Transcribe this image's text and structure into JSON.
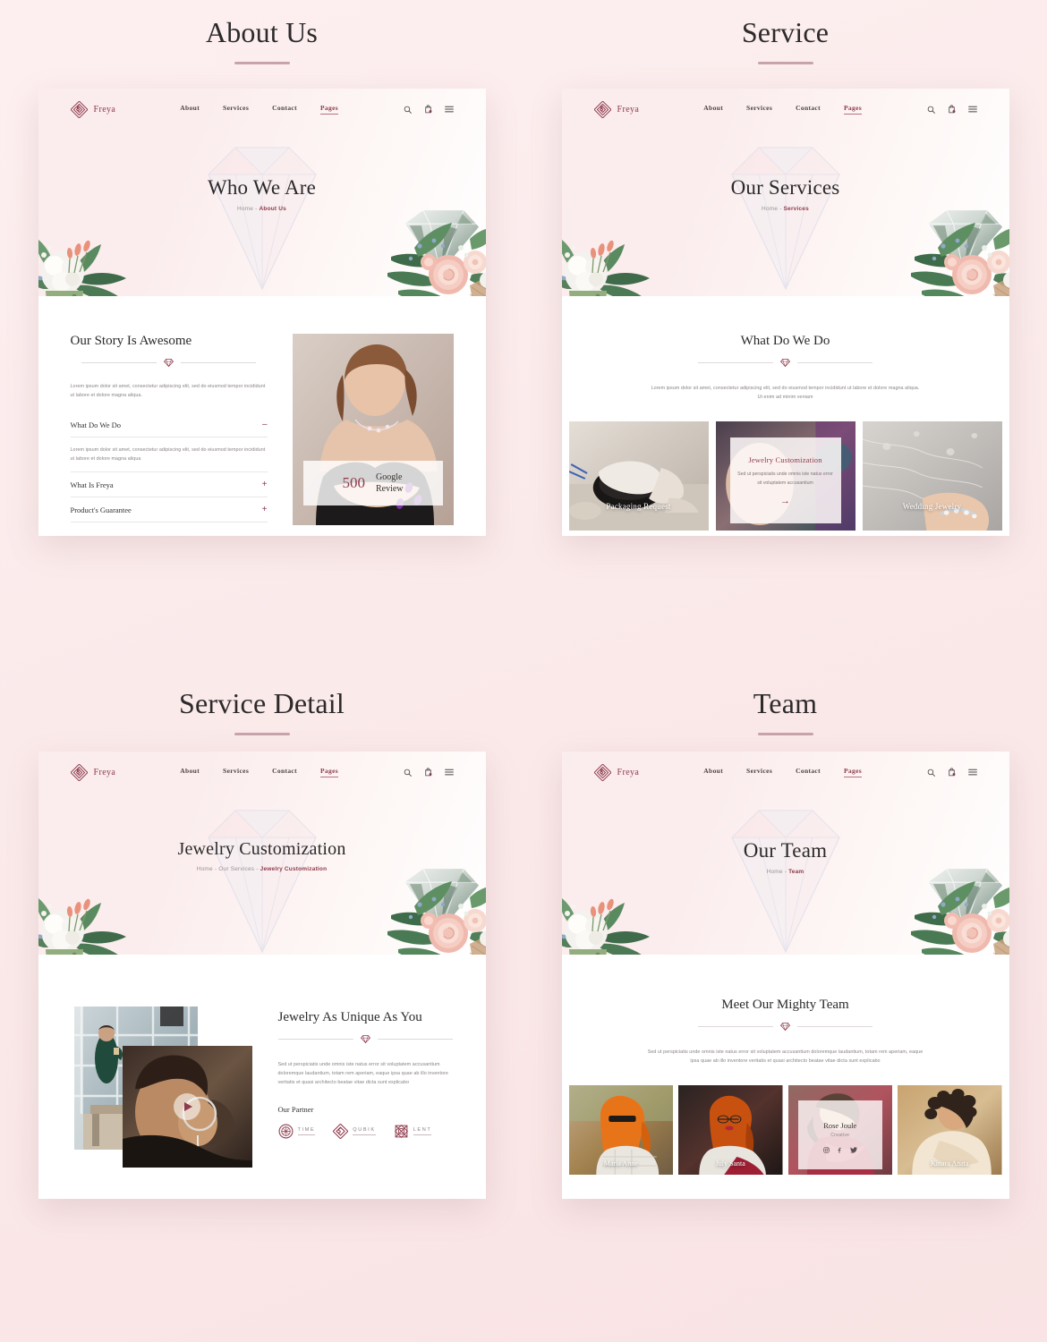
{
  "page": {
    "background_start": "#fdeff0",
    "background_end": "#f9e3e4",
    "accent": "#8e3b4c",
    "rule_color": "#c9a3ab"
  },
  "sections": [
    {
      "title": "About Us"
    },
    {
      "title": "Service"
    },
    {
      "title": "Service Detail"
    },
    {
      "title": "Team"
    }
  ],
  "nav": {
    "brand": "Freya",
    "links": [
      {
        "label": "About",
        "active": false
      },
      {
        "label": "Services",
        "active": false
      },
      {
        "label": "Contact",
        "active": false
      },
      {
        "label": "Pages",
        "active": true
      }
    ],
    "icons": [
      {
        "name": "search-icon"
      },
      {
        "name": "shopping-bag-icon"
      },
      {
        "name": "hamburger-menu-icon"
      }
    ]
  },
  "about": {
    "hero_title": "Who We Are",
    "breadcrumb_home": "Home",
    "breadcrumb_sep": "-",
    "breadcrumb_current": "About Us",
    "story_title": "Our Story Is Awesome",
    "story_text": "Lorem ipsum dolor sit amet, consectetur adipiscing elit, sed do eiusmod tempor incididunt ut labore et dolore magna aliqua.",
    "accordion": [
      {
        "label": "What Do We Do",
        "sign": "–",
        "open": true,
        "body": "Lorem ipsum dolor sit amet, consectetur adipiscing elit, sed do eiusmod tempor incididunt ut labore et dolore magna aliqua"
      },
      {
        "label": "What Is Freya",
        "sign": "+",
        "open": false,
        "body": ""
      },
      {
        "label": "Product's Guarantee",
        "sign": "+",
        "open": false,
        "body": ""
      }
    ],
    "review_number": "500",
    "review_label_line1": "Google",
    "review_label_line2": "Review"
  },
  "service": {
    "hero_title": "Our Services",
    "breadcrumb_home": "Home",
    "breadcrumb_sep": "-",
    "breadcrumb_current": "Services",
    "block_title": "What Do We Do",
    "block_text": "Lorem ipsum dolor sit amet, consectetur adipiscing elit, sed do eiusmod tempor incididunt ut labore et dolore magna aliqua. Ut enim ad minim veniam",
    "cards": [
      {
        "name": "Packaging Request",
        "featured": false
      },
      {
        "name": "Jewelry Customization",
        "featured": true,
        "text": "Sed ut perspiciatis unde omnis iste natus error sit voluptatem accusantium",
        "arrow": "→"
      },
      {
        "name": "Wedding Jewelry",
        "featured": false
      }
    ]
  },
  "service_detail": {
    "hero_title": "Jewelry Customization",
    "breadcrumb_home": "Home",
    "breadcrumb_mid": "Our Services",
    "breadcrumb_sep": "-",
    "breadcrumb_current": "Jewelry Customization",
    "block_title": "Jewelry As Unique As You",
    "block_text": "Sed ut perspiciatis unde omnis iste natus error sit voluptatem accusantium doloremque laudantium, totam rem aperiam, eaque ipsa quae ab illo inventore veritatis et quasi architecto beatae vitae dicta sunt explicabo",
    "partner_label": "Our Partner",
    "partners": [
      {
        "name": "TIME",
        "mark": "circle-ornament-icon"
      },
      {
        "name": "QUBIK",
        "mark": "diamond-ornament-icon"
      },
      {
        "name": "LENT",
        "mark": "square-ornament-icon"
      }
    ],
    "play_button": "play-icon"
  },
  "team": {
    "hero_title": "Our Team",
    "breadcrumb_home": "Home",
    "breadcrumb_sep": "-",
    "breadcrumb_current": "Team",
    "block_title": "Meet Our Mighty Team",
    "block_text": "Sed ut perspiciatis unde omnis iste natus error sit voluptatem accusantium doloremque laudantium, totam rem aperiam, eaque ipsa quae ab illo inventore veritatis et quasi architecto beatae vitae dicta sunt explicabo",
    "members": [
      {
        "name": "Maria Anne",
        "role": "",
        "featured": false
      },
      {
        "name": "July Santa",
        "role": "",
        "featured": false
      },
      {
        "name": "Rose Joule",
        "role": "Creative",
        "featured": true,
        "socials": [
          "instagram-icon",
          "facebook-icon",
          "twitter-icon"
        ]
      },
      {
        "name": "Kinara Anata",
        "role": "",
        "featured": false
      }
    ]
  }
}
